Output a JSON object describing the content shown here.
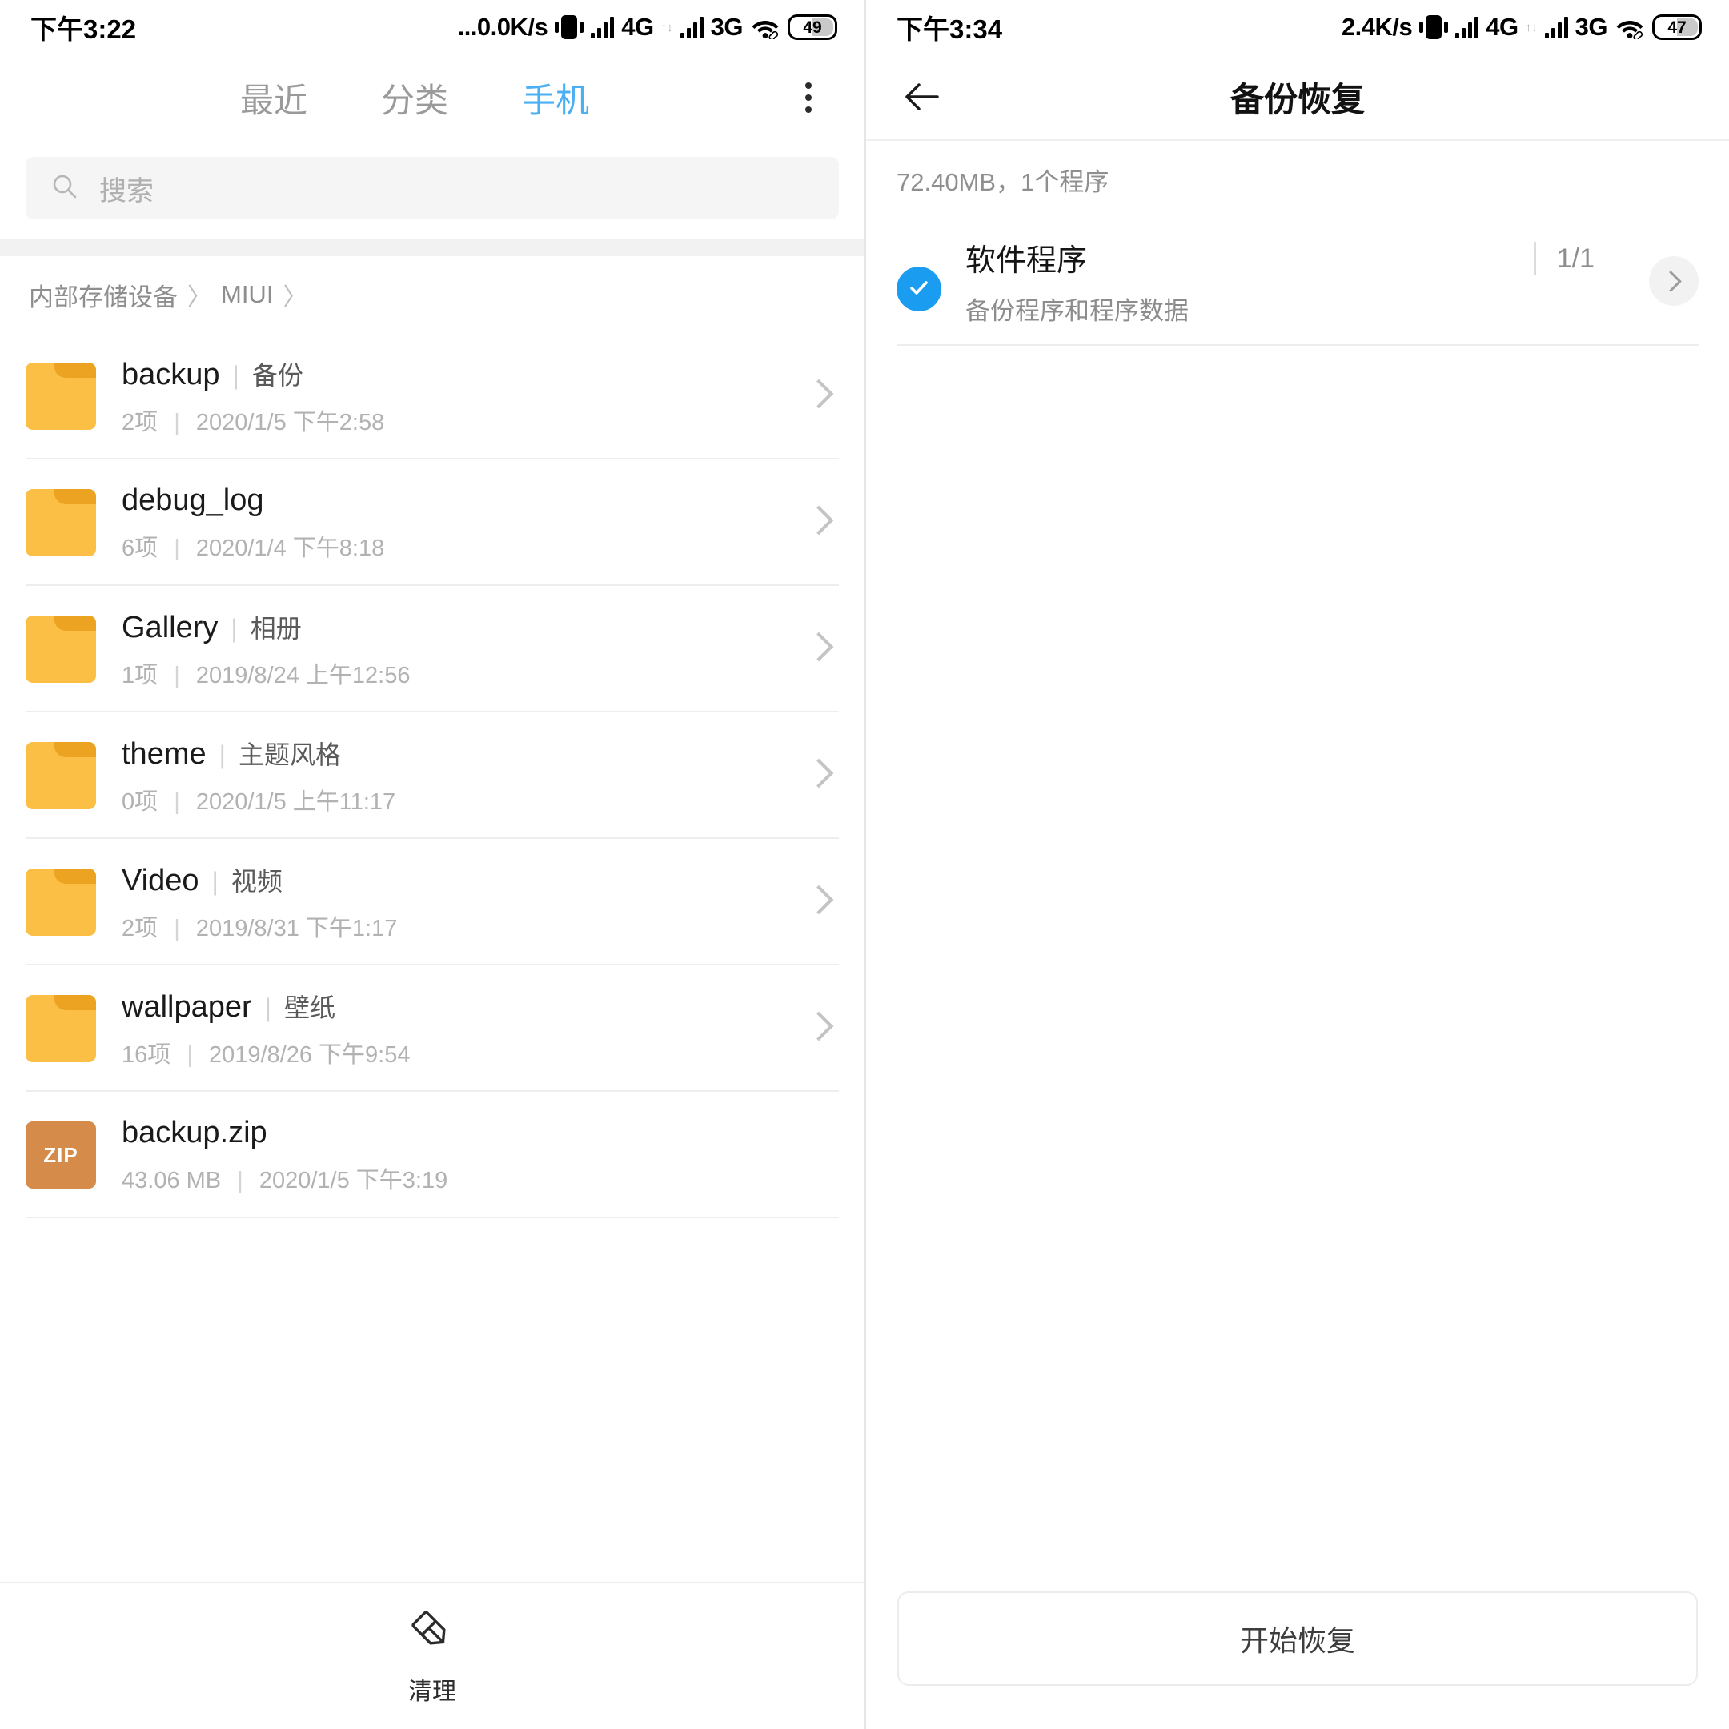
{
  "left": {
    "status": {
      "time": "下午3:22",
      "net_speed": "...0.0K/s",
      "net_type_1": "4G",
      "net_type_2": "3G",
      "battery": "49",
      "vibrate_icon": "vibrate-icon",
      "wifi_icon": "wifi-icon"
    },
    "tabs": [
      {
        "label": "最近",
        "active": false
      },
      {
        "label": "分类",
        "active": false
      },
      {
        "label": "手机",
        "active": true
      }
    ],
    "overflow_icon": "more-vertical-icon",
    "search": {
      "placeholder": "搜索",
      "value": "",
      "icon": "search-icon"
    },
    "breadcrumb": {
      "root": "内部存储设备",
      "sep1": "〉",
      "folder": "MIUI",
      "sep2": "〉"
    },
    "files": [
      {
        "icon": "folder-icon",
        "name": "backup",
        "alias_sep": "|",
        "alias": "备份",
        "count": "2项",
        "sub_sep": "|",
        "date": "2020/1/5 下午2:58",
        "has_chevron": true
      },
      {
        "icon": "folder-icon",
        "name": "debug_log",
        "alias_sep": "",
        "alias": "",
        "count": "6项",
        "sub_sep": "|",
        "date": "2020/1/4 下午8:18",
        "has_chevron": true
      },
      {
        "icon": "folder-icon",
        "name": "Gallery",
        "alias_sep": "|",
        "alias": "相册",
        "count": "1项",
        "sub_sep": "|",
        "date": "2019/8/24 上午12:56",
        "has_chevron": true
      },
      {
        "icon": "folder-icon",
        "name": "theme",
        "alias_sep": "|",
        "alias": "主题风格",
        "count": "0项",
        "sub_sep": "|",
        "date": "2020/1/5 上午11:17",
        "has_chevron": true
      },
      {
        "icon": "folder-icon",
        "name": "Video",
        "alias_sep": "|",
        "alias": "视频",
        "count": "2项",
        "sub_sep": "|",
        "date": "2019/8/31 下午1:17",
        "has_chevron": true
      },
      {
        "icon": "folder-icon",
        "name": "wallpaper",
        "alias_sep": "|",
        "alias": "壁纸",
        "count": "16项",
        "sub_sep": "|",
        "date": "2019/8/26 下午9:54",
        "has_chevron": true
      },
      {
        "icon": "zip-icon",
        "icon_label": "ZIP",
        "name": "backup.zip",
        "alias_sep": "",
        "alias": "",
        "count": "43.06 MB",
        "sub_sep": "|",
        "date": "2020/1/5 下午3:19",
        "has_chevron": false
      }
    ],
    "bottom": {
      "clean_label": "清理",
      "clean_icon": "broom-icon"
    }
  },
  "right": {
    "status": {
      "time": "下午3:34",
      "net_speed": "2.4K/s",
      "net_type_1": "4G",
      "net_type_2": "3G",
      "battery": "47",
      "vibrate_icon": "vibrate-icon",
      "wifi_icon": "wifi-icon"
    },
    "appbar": {
      "title": "备份恢复",
      "back_icon": "arrow-left-icon"
    },
    "summary": "72.40MB，1个程序",
    "options": [
      {
        "checked": true,
        "check_icon": "check-icon",
        "title": "软件程序",
        "subtitle": "备份程序和程序数据",
        "count": "1/1",
        "chevron_icon": "chevron-right-icon"
      }
    ],
    "bottom": {
      "restore_label": "开始恢复"
    }
  },
  "colors": {
    "accent_blue": "#4aaff5",
    "check_blue": "#1a9cf0",
    "folder_amber": "#fbbf45",
    "folder_tab": "#eda322",
    "zip_brown": "#d58b4a"
  }
}
